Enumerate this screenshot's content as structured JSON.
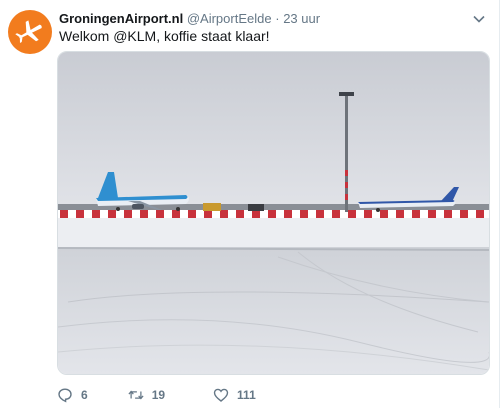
{
  "tweet": {
    "account_name": "GroningenAirport.nl",
    "handle": "@AirportEelde",
    "separator": "·",
    "time": "23 uur",
    "text": "Welkom @KLM, koffie staat klaar!"
  },
  "actions": {
    "reply_count": "6",
    "retweet_count": "19",
    "like_count": "111"
  },
  "colors": {
    "avatar_bg": "#f27c1e",
    "text_secondary": "#657786"
  },
  "icons": [
    "airplane-icon",
    "chevron-down-icon",
    "reply-icon",
    "retweet-icon",
    "like-icon"
  ]
}
